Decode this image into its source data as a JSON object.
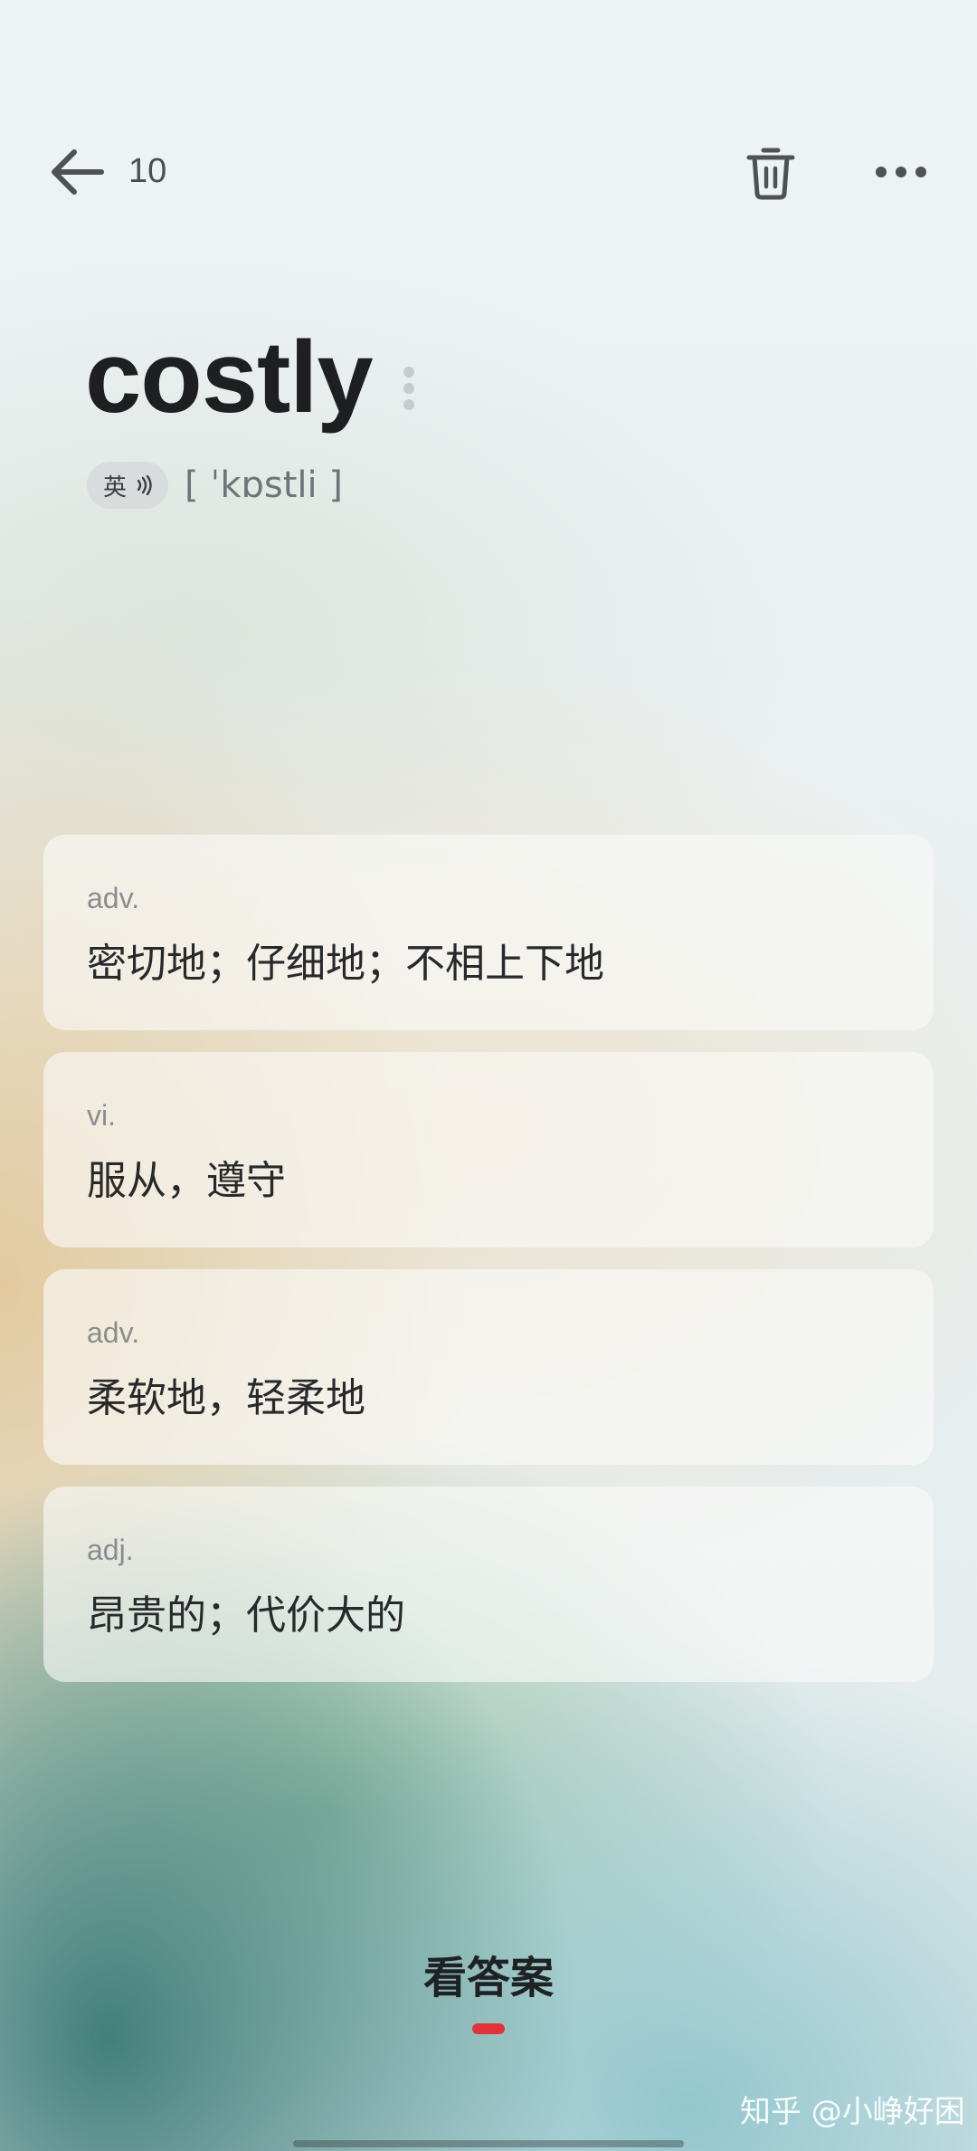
{
  "header": {
    "count": "10"
  },
  "word": {
    "text": "costly",
    "pronunciation": {
      "lang": "英",
      "phonetic": "[ ˈkɒstli ]"
    }
  },
  "definitions": [
    {
      "pos": "adv.",
      "meaning": "密切地；仔细地；不相上下地"
    },
    {
      "pos": "vi.",
      "meaning": "服从，遵守"
    },
    {
      "pos": "adv.",
      "meaning": "柔软地，轻柔地"
    },
    {
      "pos": "adj.",
      "meaning": "昂贵的；代价大的"
    }
  ],
  "footer": {
    "answer_label": "看答案"
  },
  "watermark": "知乎 @小峥好困",
  "colors": {
    "accent": "#e2333c",
    "text_primary": "#1d1f21",
    "text_secondary": "#8a8d8f"
  },
  "icons": {
    "back": "arrow-left-icon",
    "trash": "trash-icon",
    "more": "more-horizontal-icon",
    "speaker": "speaker-icon",
    "word_menu": "vertical-dots-icon"
  }
}
